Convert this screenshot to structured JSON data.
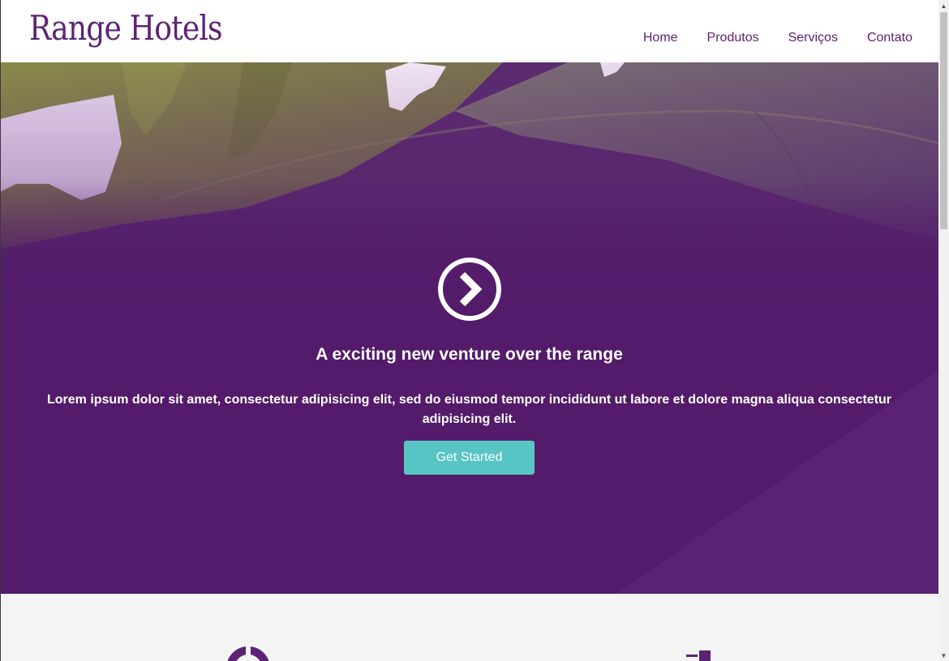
{
  "header": {
    "logo_text": "Range Hotels",
    "nav": [
      {
        "label": "Home"
      },
      {
        "label": "Produtos"
      },
      {
        "label": "Serviços"
      },
      {
        "label": "Contato"
      }
    ]
  },
  "hero": {
    "icon": "chevron-circle-right-icon",
    "title": "A exciting new venture over the range",
    "text": "Lorem ipsum dolor sit amet, consectetur adipisicing elit, sed do eiusmod tempor incididunt ut labore et dolore magna aliqua consectetur adipisicing elit.",
    "button_label": "Get Started"
  },
  "features": {
    "icons": [
      "ring-icon",
      "square-icon"
    ]
  },
  "colors": {
    "brand": "#5e2275",
    "hero_overlay": "#531b69",
    "accent": "#56c5c4",
    "section_bg": "#f4f4f4"
  },
  "scrollbar": {
    "up_icon": "scroll-up-arrow-icon",
    "down_icon": "scroll-down-arrow-icon"
  }
}
